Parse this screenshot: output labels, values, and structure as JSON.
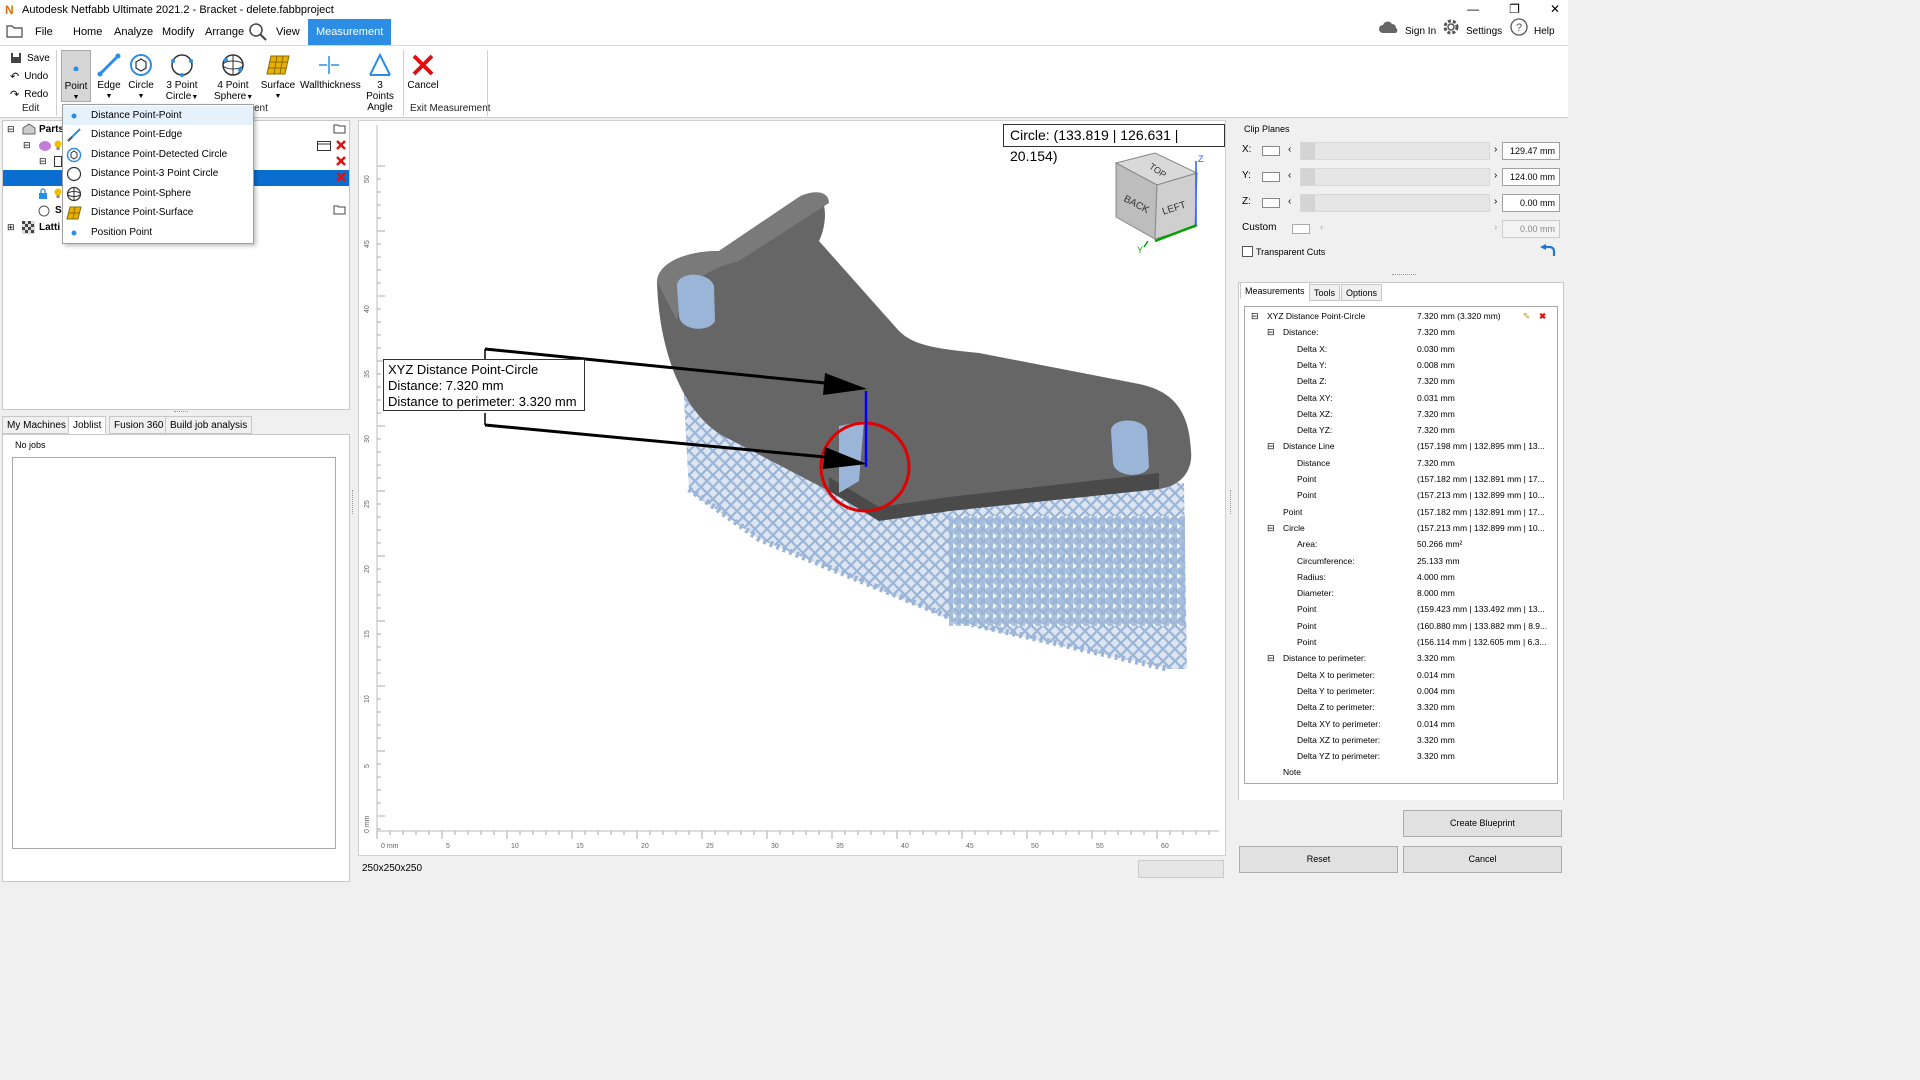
{
  "window": {
    "title": "Autodesk Netfabb Ultimate 2021.2 - Bracket - delete.fabbproject"
  },
  "menu": {
    "items": [
      "File",
      "Home",
      "Analyze",
      "Modify",
      "Arrange",
      "View",
      "Measurement"
    ],
    "active": "Measurement",
    "sign_in": "Sign In",
    "settings": "Settings",
    "help": "Help"
  },
  "ribbon": {
    "edit": {
      "save": "Save",
      "undo": "Undo",
      "redo": "Redo",
      "label": "Edit"
    },
    "tools": [
      {
        "line1": "Point",
        "line2": ""
      },
      {
        "line1": "Edge",
        "line2": ""
      },
      {
        "line1": "Circle",
        "line2": ""
      },
      {
        "line1": "3 Point",
        "line2": "Circle"
      },
      {
        "line1": "4 Point",
        "line2": "Sphere"
      },
      {
        "line1": "Surface",
        "line2": ""
      },
      {
        "line1": "Wallthickness",
        "line2": ""
      },
      {
        "line1": "3 Points",
        "line2": "Angle"
      }
    ],
    "measure_group_label_fragment": "ent",
    "cancel": "Cancel",
    "exit_label": "Exit Measurement"
  },
  "dropdown": {
    "items": [
      {
        "label": "Distance Point-Point",
        "icon": "point-icon"
      },
      {
        "label": "Distance Point-Edge",
        "icon": "edge-icon"
      },
      {
        "label": "Distance Point-Detected Circle",
        "icon": "detected-circle-icon"
      },
      {
        "label": "Distance Point-3 Point Circle",
        "icon": "circle-icon"
      },
      {
        "label": "Distance Point-Sphere",
        "icon": "sphere-icon"
      },
      {
        "label": "Distance Point-Surface",
        "icon": "surface-icon"
      },
      {
        "label": "Position Point",
        "icon": "point-icon"
      }
    ]
  },
  "tree": {
    "rows": [
      {
        "label": "Parts"
      },
      {
        "label": ""
      },
      {
        "label": ""
      },
      {
        "label": ""
      },
      {
        "label": ""
      },
      {
        "label": "S"
      },
      {
        "label": "Latti"
      }
    ]
  },
  "jobs": {
    "tabs": [
      "My Machines",
      "Joblist",
      "Fusion 360",
      "Build job analysis"
    ],
    "active": "Joblist",
    "group_label": "No jobs"
  },
  "viewport": {
    "circle_readout": "Circle: (133.819 | 126.631 | 20.154)",
    "callout": {
      "title": "XYZ Distance Point-Circle",
      "distance": "Distance: 7.320 mm",
      "perimeter": "Distance to perimeter: 3.320 mm"
    },
    "viewcube": {
      "top": "TOP",
      "back": "BACK",
      "left": "LEFT",
      "z": "Z",
      "y": "Y"
    },
    "ruler_h_labels": [
      "0 mm",
      "5",
      "10",
      "15",
      "20",
      "25",
      "30",
      "35",
      "40",
      "45",
      "50",
      "55",
      "60"
    ],
    "ruler_v_labels": [
      "50",
      "45",
      "40",
      "35",
      "30",
      "25",
      "20",
      "15",
      "10",
      "5",
      "0 mm"
    ],
    "status": "250x250x250",
    "colors": {
      "part": "#666666",
      "lattice": "#9bb5d8",
      "circle": "#e00000",
      "distance_line": "#0000ff"
    }
  },
  "clip": {
    "title": "Clip Planes",
    "rows": [
      {
        "axis": "X:",
        "value": "129.47 mm"
      },
      {
        "axis": "Y:",
        "value": "124.00 mm"
      },
      {
        "axis": "Z:",
        "value": "0.00 mm"
      },
      {
        "axis": "Custom",
        "value": "0.00 mm"
      }
    ],
    "transparent": "Transparent Cuts"
  },
  "right_tabs": [
    "Measurements",
    "Tools",
    "Options"
  ],
  "right_active_tab": "Measurements",
  "measurements": [
    {
      "key": "XYZ Distance Point-Circle",
      "value": "7.320 mm (3.320 mm)",
      "level": 0,
      "expander": true
    },
    {
      "key": "Distance:",
      "value": "7.320 mm",
      "level": 1,
      "expander": true
    },
    {
      "key": "Delta X:",
      "value": "0.030 mm",
      "level": 2
    },
    {
      "key": "Delta Y:",
      "value": "0.008 mm",
      "level": 2
    },
    {
      "key": "Delta Z:",
      "value": "7.320 mm",
      "level": 2
    },
    {
      "key": "Delta XY:",
      "value": "0.031 mm",
      "level": 2
    },
    {
      "key": "Delta XZ:",
      "value": "7.320 mm",
      "level": 2
    },
    {
      "key": "Delta YZ:",
      "value": "7.320 mm",
      "level": 2
    },
    {
      "key": "Distance Line",
      "value": "(157.198 mm | 132.895 mm | 13...",
      "level": 1,
      "expander": true
    },
    {
      "key": "Distance",
      "value": "7.320 mm",
      "level": 2
    },
    {
      "key": "Point",
      "value": "(157.182 mm | 132.891 mm | 17...",
      "level": 2
    },
    {
      "key": "Point",
      "value": "(157.213 mm | 132.899 mm | 10...",
      "level": 2
    },
    {
      "key": "Point",
      "value": "(157.182 mm | 132.891 mm | 17...",
      "level": 1
    },
    {
      "key": "Circle",
      "value": "(157.213 mm | 132.899 mm | 10...",
      "level": 1,
      "expander": true
    },
    {
      "key": "Area:",
      "value": "50.266 mm²",
      "level": 2
    },
    {
      "key": "Circumference:",
      "value": "25.133 mm",
      "level": 2
    },
    {
      "key": "Radius:",
      "value": "4.000 mm",
      "level": 2
    },
    {
      "key": "Diameter:",
      "value": "8.000 mm",
      "level": 2
    },
    {
      "key": "Point",
      "value": "(159.423 mm | 133.492 mm | 13...",
      "level": 2
    },
    {
      "key": "Point",
      "value": "(160.880 mm | 133.882 mm | 8.9...",
      "level": 2
    },
    {
      "key": "Point",
      "value": "(156.114 mm | 132.605 mm | 6.3...",
      "level": 2
    },
    {
      "key": "Distance to perimeter:",
      "value": "3.320 mm",
      "level": 1,
      "expander": true
    },
    {
      "key": "Delta X to perimeter:",
      "value": "0.014 mm",
      "level": 2
    },
    {
      "key": "Delta Y to perimeter:",
      "value": "0.004 mm",
      "level": 2
    },
    {
      "key": "Delta Z to perimeter:",
      "value": "3.320 mm",
      "level": 2
    },
    {
      "key": "Delta XY to perimeter:",
      "value": "0.014 mm",
      "level": 2
    },
    {
      "key": "Delta XZ to perimeter:",
      "value": "3.320 mm",
      "level": 2
    },
    {
      "key": "Delta YZ to perimeter:",
      "value": "3.320 mm",
      "level": 2
    },
    {
      "key": "Note",
      "value": "",
      "level": 1
    }
  ],
  "buttons": {
    "blueprint": "Create Blueprint",
    "reset": "Reset",
    "cancel": "Cancel"
  }
}
